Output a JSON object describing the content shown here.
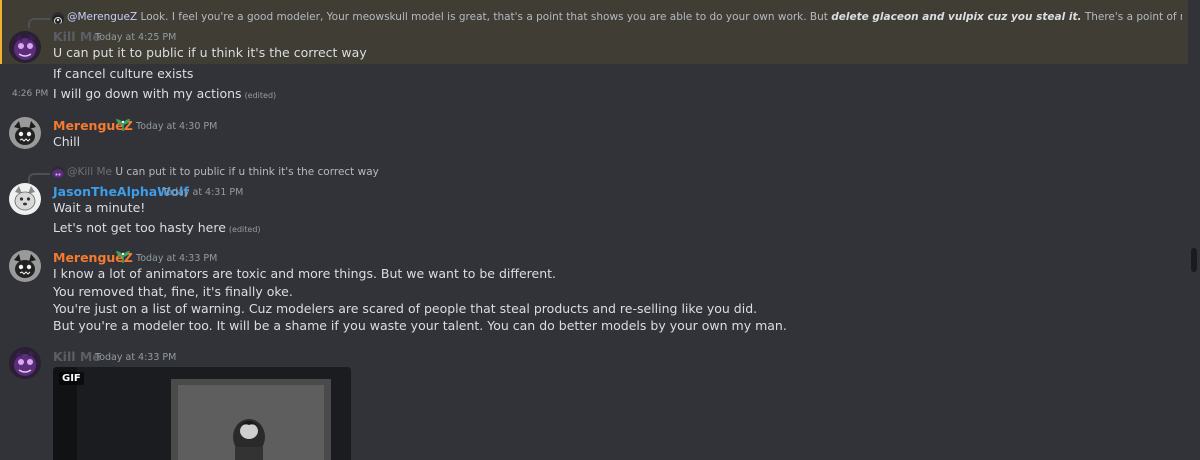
{
  "colors": {
    "background": "#313338",
    "highlight": "#3f3d34",
    "highlight_bar": "#f0b232",
    "merengue": "#f47b30",
    "jason": "#3d9ee9",
    "killme": "#5c5e66",
    "mention": "#c9cdfb"
  },
  "messages": [
    {
      "reply": {
        "mention": "@MerengueZ",
        "text_before": "Look. I feel you're a good modeler, Your meowskull model is great, that's a point that shows you are able to do your own work. But ",
        "text_bold": "delete glaceon and vulpix cuz you steal it.",
        "text_after": " There's a point of modify a model, and get money with tha"
      },
      "author": "Kill Me",
      "timestamp": "Today at 4:25 PM",
      "lines": [
        "U can put it to public if u think it's the correct way"
      ]
    },
    {
      "continuation": true,
      "lines": [
        "If cancel culture exists"
      ]
    },
    {
      "continuation": true,
      "hover_time": "4:26 PM",
      "lines": [
        "I will go down with my actions"
      ],
      "edited": "(edited)"
    },
    {
      "author": "MerengueZ",
      "timestamp": "Today at 4:30 PM",
      "badge_icon": "leaf-sprout-icon",
      "lines": [
        "Chill"
      ]
    },
    {
      "reply": {
        "mention": "@Kill Me",
        "text": "U can put it to public if u think it's the correct way"
      },
      "author": "JasonTheAlphaWolf",
      "timestamp": "Today at 4:31 PM",
      "lines": [
        "Wait a minute!",
        "Let's not get too hasty here"
      ],
      "edited": "(edited)"
    },
    {
      "author": "MerengueZ",
      "timestamp": "Today at 4:33 PM",
      "badge_icon": "leaf-sprout-icon",
      "lines": [
        "I know a lot of animators are toxic and more things. But we want to be different.",
        "You removed that, fine, it's finally oke.",
        "You're just on a list of warning. Cuz modelers are scared of people that steal products and re-selling like you did.",
        "But you're a modeler too. It will be a shame if you waste your talent. You can do better models by your own my man."
      ]
    },
    {
      "author": "Kill Me",
      "timestamp": "Today at 4:33 PM",
      "attachment_label": "GIF"
    }
  ]
}
